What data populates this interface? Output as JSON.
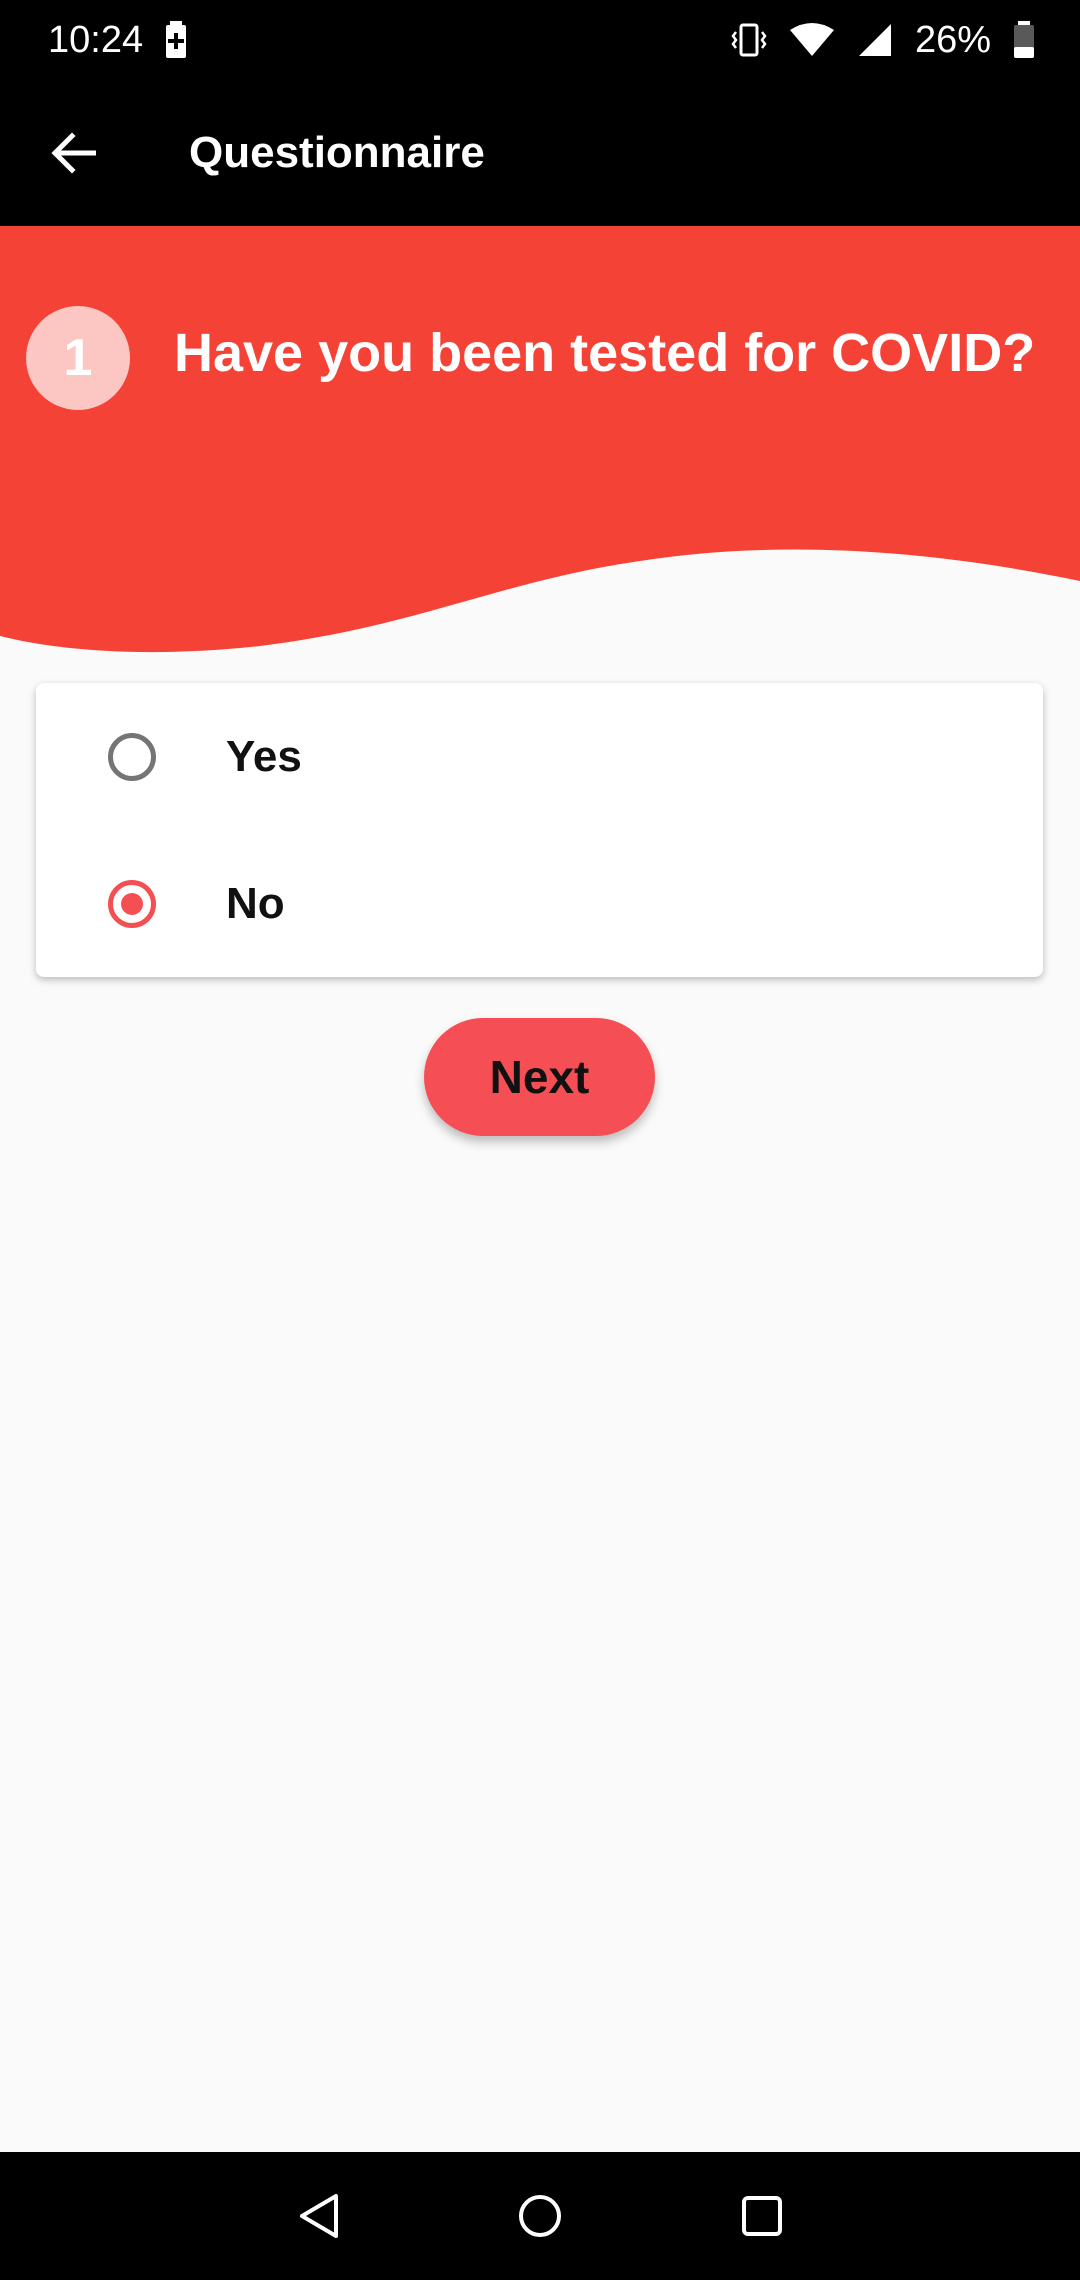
{
  "status_bar": {
    "time": "10:24",
    "battery_percent": "26%",
    "icons": [
      "battery-charging-icon",
      "vibrate-icon",
      "wifi-icon",
      "cell-signal-icon",
      "battery-icon"
    ]
  },
  "app_bar": {
    "title": "Questionnaire",
    "back_icon": "arrow-left-icon"
  },
  "question": {
    "number": "1",
    "text": "Have you been tested for COVID?"
  },
  "options": [
    {
      "label": "Yes",
      "selected": false
    },
    {
      "label": "No",
      "selected": true
    }
  ],
  "next_button": {
    "label": "Next"
  },
  "nav_bar": {
    "icons": [
      "back-triangle-icon",
      "home-circle-icon",
      "recents-square-icon"
    ]
  },
  "colors": {
    "header_red": "#f44336",
    "accent_red": "#f54f55",
    "background": "#fafafa",
    "app_bar": "#000000"
  }
}
